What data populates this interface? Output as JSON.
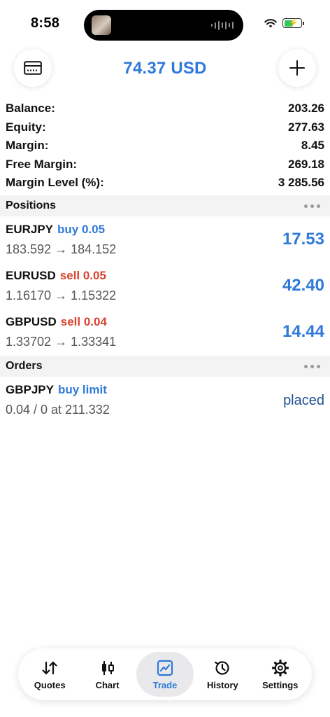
{
  "status_bar": {
    "time": "8:58"
  },
  "header": {
    "title": "74.37 USD",
    "left_icon": "card-icon",
    "right_icon": "plus-icon"
  },
  "summary": [
    {
      "label": "Balance:",
      "value": "203.26"
    },
    {
      "label": "Equity:",
      "value": "277.63"
    },
    {
      "label": "Margin:",
      "value": "8.45"
    },
    {
      "label": "Free Margin:",
      "value": "269.18"
    },
    {
      "label": "Margin Level (%):",
      "value": "3 285.56"
    }
  ],
  "positions": {
    "title": "Positions",
    "items": [
      {
        "symbol": "EURJPY",
        "side": "buy 0.05",
        "prices": "183.592 → 184.152",
        "profit": "17.53"
      },
      {
        "symbol": "EURUSD",
        "side": "sell 0.05",
        "prices": "1.16170 → 1.15322",
        "profit": "42.40"
      },
      {
        "symbol": "GBPUSD",
        "side": "sell 0.04",
        "prices": "1.33702 → 1.33341",
        "profit": "14.44"
      }
    ]
  },
  "orders": {
    "title": "Orders",
    "items": [
      {
        "symbol": "GBPJPY",
        "side": "buy limit",
        "details": "0.04 / 0 at 211.332",
        "status": "placed"
      }
    ]
  },
  "tabs": [
    {
      "label": "Quotes",
      "icon": "sort-arrows-icon"
    },
    {
      "label": "Chart",
      "icon": "candlestick-icon"
    },
    {
      "label": "Trade",
      "icon": "trade-chart-icon",
      "active": true
    },
    {
      "label": "History",
      "icon": "history-icon"
    },
    {
      "label": "Settings",
      "icon": "gear-icon"
    }
  ],
  "colors": {
    "accent": "#2f7ad8",
    "sell": "#d9432f",
    "order_status": "#1f4f8f",
    "section_bg": "#f3f3f3"
  }
}
